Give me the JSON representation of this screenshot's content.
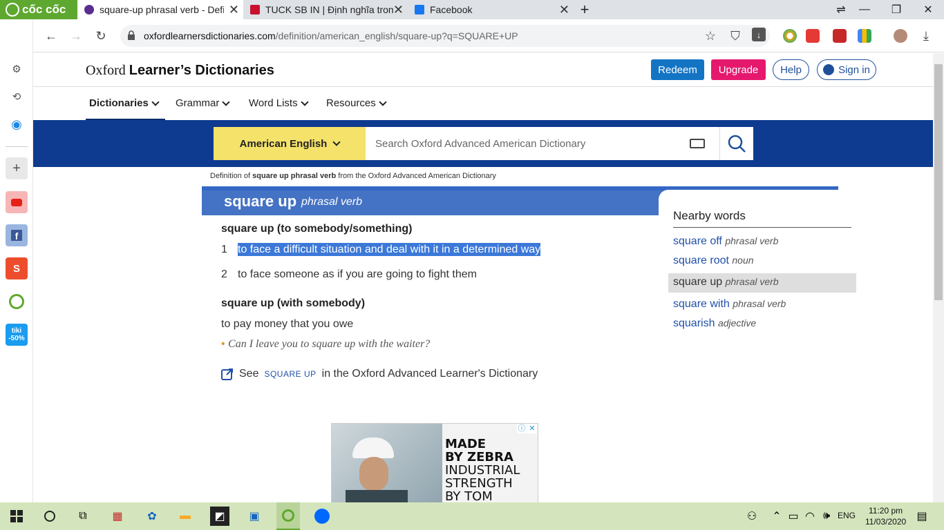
{
  "browser": {
    "brand": "cốc cốc",
    "tabs": [
      {
        "title": "square-up phrasal verb - Defi",
        "active": true
      },
      {
        "title": "TUCK SB IN | Định nghĩa trong",
        "active": false
      },
      {
        "title": "Facebook",
        "active": false
      }
    ],
    "url_host": "oxfordlearnersdictionaries.com",
    "url_path": "/definition/american_english/square-up?q=SQUARE+UP"
  },
  "site": {
    "logo_plain": "Oxford ",
    "logo_bold": "Learner’s Dictionaries",
    "buttons": {
      "redeem": "Redeem",
      "upgrade": "Upgrade",
      "help": "Help",
      "signin": "Sign in"
    },
    "nav": [
      "Dictionaries",
      "Grammar",
      "Word Lists",
      "Resources"
    ],
    "dictionary_select": "American English",
    "search_placeholder": "Search Oxford Advanced American Dictionary"
  },
  "breadcrumb": {
    "prefix": "Definition of ",
    "term": "square up phrasal verb",
    "suffix": " from the Oxford Advanced American Dictionary"
  },
  "entry": {
    "headword": "square up",
    "pos": "phrasal verb",
    "sense_group_1": "square up (to somebody/something)",
    "senses": [
      {
        "num": "1",
        "text": "to face a difficult situation and deal with it in a determined way",
        "selected": true
      },
      {
        "num": "2",
        "text": "to face someone as if you are going to fight them",
        "selected": false
      }
    ],
    "sense_group_2": "square up (with somebody)",
    "def2": "to pay money that you owe",
    "example": "Can I leave you to square up with the waiter?",
    "see_prefix": "See",
    "see_link": "SQUARE UP",
    "see_suffix": "in the Oxford Advanced Learner's Dictionary"
  },
  "nearby": {
    "title": "Nearby words",
    "items": [
      {
        "word": "square off",
        "pos": "phrasal verb"
      },
      {
        "word": "square root",
        "pos": "noun"
      },
      {
        "word": "square up",
        "pos": "phrasal verb"
      },
      {
        "word": "square with",
        "pos": "phrasal verb"
      },
      {
        "word": "squarish",
        "pos": "adjective"
      }
    ]
  },
  "ad": {
    "text_lines": [
      "MADE",
      "BY ZEBRA",
      "INDUSTRIAL",
      "STRENGTH",
      "BY TOM"
    ]
  },
  "sidebar": {
    "tiki_label": "tiki",
    "tiki_badge": "-50%"
  },
  "taskbar": {
    "lang": "ENG",
    "time": "11:20 pm",
    "date": "11/03/2020"
  },
  "colors": {
    "brand_green": "#5fa82f",
    "band_blue": "#0e3b8f",
    "headbar_blue": "#4472c4",
    "redeem": "#1474c4",
    "upgrade": "#e6186e",
    "selection": "#3b78d8"
  }
}
